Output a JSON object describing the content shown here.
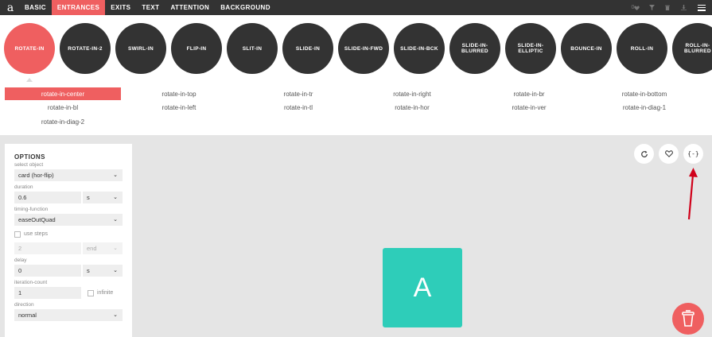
{
  "app": {
    "logo": "a",
    "nav_tabs": [
      {
        "label": "BASIC"
      },
      {
        "label": "ENTRANCES"
      },
      {
        "label": "EXITS"
      },
      {
        "label": "TEXT"
      },
      {
        "label": "ATTENTION"
      },
      {
        "label": "BACKGROUND"
      }
    ],
    "active_tab": "ENTRANCES",
    "favorites_count": "0"
  },
  "bubbles": [
    {
      "label": "ROTATE-IN"
    },
    {
      "label": "ROTATE-IN-2"
    },
    {
      "label": "SWIRL-IN"
    },
    {
      "label": "FLIP-IN"
    },
    {
      "label": "SLIT-IN"
    },
    {
      "label": "SLIDE-IN"
    },
    {
      "label": "SLIDE-IN-FWD"
    },
    {
      "label": "SLIDE-IN-BCK"
    },
    {
      "label": "SLIDE-IN-BLURRED"
    },
    {
      "label": "SLIDE-IN-ELLIPTIC"
    },
    {
      "label": "BOUNCE-IN"
    },
    {
      "label": "ROLL-IN"
    },
    {
      "label": "ROLL-IN-BLURRED"
    }
  ],
  "variants": [
    {
      "label": "rotate-in-center"
    },
    {
      "label": "rotate-in-top"
    },
    {
      "label": "rotate-in-tr"
    },
    {
      "label": "rotate-in-right"
    },
    {
      "label": "rotate-in-br"
    },
    {
      "label": "rotate-in-bottom"
    },
    {
      "label": "rotate-in-bl"
    },
    {
      "label": "rotate-in-left"
    },
    {
      "label": "rotate-in-tl"
    },
    {
      "label": "rotate-in-hor"
    },
    {
      "label": "rotate-in-ver"
    },
    {
      "label": "rotate-in-diag-1"
    },
    {
      "label": "rotate-in-diag-2"
    }
  ],
  "options": {
    "title": "OPTIONS",
    "select_object_label": "select object",
    "select_object_value": "card (hor-flip)",
    "duration_label": "duration",
    "duration_value": "0.6",
    "duration_unit": "s",
    "timing_label": "timing-function",
    "timing_value": "easeOutQuad",
    "use_steps_label": "use steps",
    "steps_value": "2",
    "steps_mode": "end",
    "delay_label": "delay",
    "delay_value": "0",
    "delay_unit": "s",
    "iteration_label": "iteration-count",
    "iteration_value": "1",
    "infinite_label": "infinite",
    "direction_label": "direction",
    "direction_value": "normal"
  },
  "stage": {
    "card_letter": "A",
    "code_button": "{-}"
  },
  "colors": {
    "accent": "#ef5f60",
    "dark": "#333333",
    "card": "#2ecdb9",
    "arrow": "#d0021b"
  }
}
